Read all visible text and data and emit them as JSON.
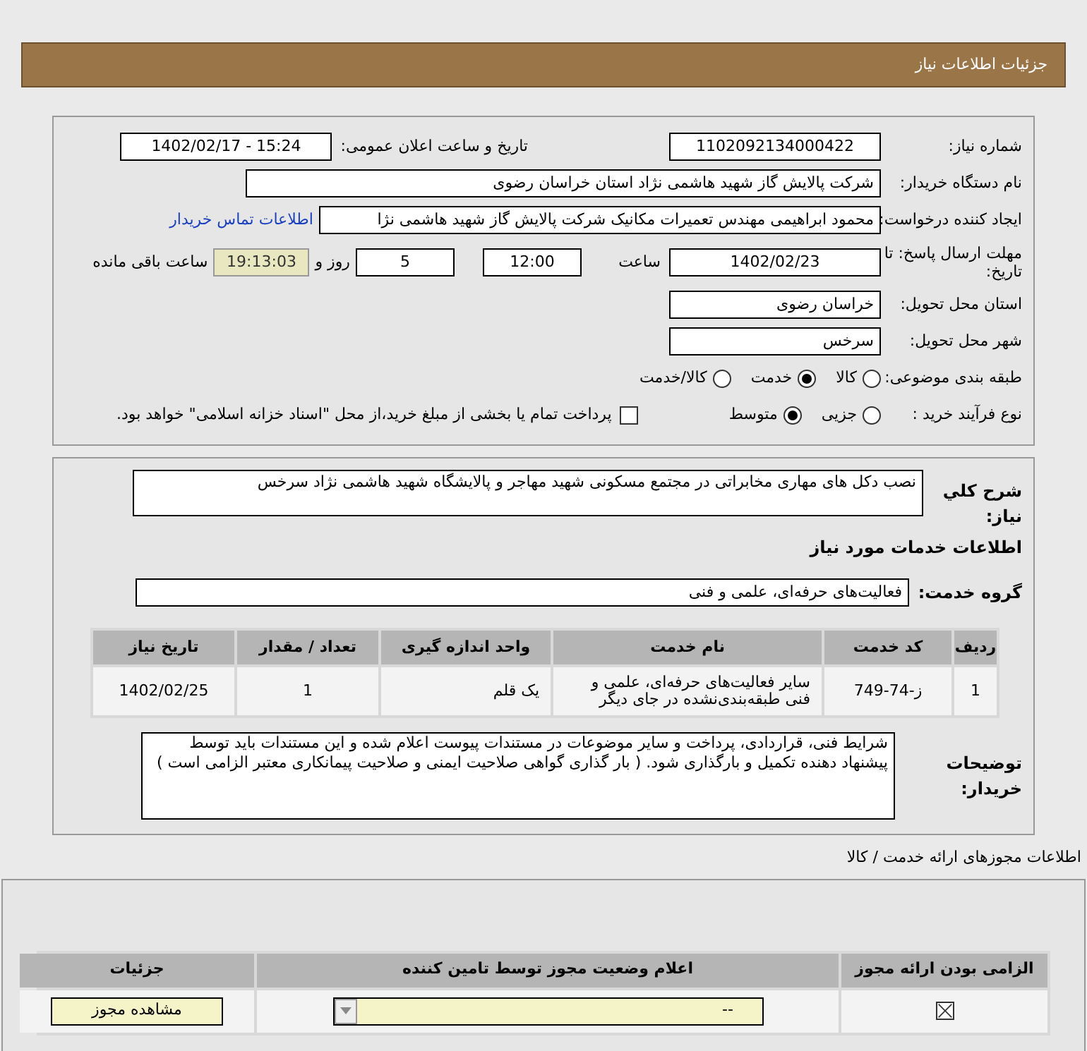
{
  "header": {
    "title": "جزئیات اطلاعات نیاز"
  },
  "details": {
    "need_number": {
      "label": "شماره نیاز:",
      "value": "1102092134000422"
    },
    "announce": {
      "label": "تاریخ و ساعت اعلان عمومی:",
      "value": "1402/02/17 - 15:24"
    },
    "buyer": {
      "label": "نام دستگاه خریدار:",
      "value": "شرکت پالایش گاز شهید هاشمی نژاد   استان خراسان رضوی"
    },
    "requester": {
      "label": "ایجاد کننده درخواست:",
      "value": "محمود ابراهیمی مهندس تعمیرات مکانیک شرکت پالایش گاز شهید هاشمی نژا",
      "link": "اطلاعات تماس خریدار"
    },
    "deadline": {
      "label": "مهلت ارسال پاسخ: تا تاریخ:",
      "date": "1402/02/23",
      "time_label": "ساعت",
      "time": "12:00",
      "days": "5",
      "days_label": "روز و",
      "remaining": "19:13:03",
      "remaining_label": "ساعت باقی مانده"
    },
    "province": {
      "label": "استان محل تحویل:",
      "value": "خراسان رضوی"
    },
    "city": {
      "label": "شهر محل تحویل:",
      "value": "سرخس"
    },
    "category": {
      "label": "طبقه بندی موضوعی:",
      "options": [
        {
          "label": "کالا",
          "selected": false
        },
        {
          "label": "خدمت",
          "selected": true
        },
        {
          "label": "کالا/خدمت",
          "selected": false
        }
      ]
    },
    "process": {
      "label": "نوع فرآیند خرید :",
      "options": [
        {
          "label": "جزیی",
          "selected": false
        },
        {
          "label": "متوسط",
          "selected": true
        }
      ],
      "treasury": {
        "label": "پرداخت تمام یا بخشی از مبلغ خرید،از محل \"اسناد خزانه اسلامی\" خواهد بود.",
        "checked": false
      }
    }
  },
  "need": {
    "description_label": "شرح کلي نياز:",
    "description": "نصب دکل های مهاری مخابراتی در مجتمع مسکونی شهید مهاجر و پالایشگاه شهید هاشمی نژاد سرخس",
    "services_title": "اطلاعات خدمات مورد نياز",
    "group_label": "گروه خدمت:",
    "group": "فعالیت‌های حرفه‌ای، علمی و فنی",
    "table": {
      "columns": [
        "ردیف",
        "کد خدمت",
        "نام خدمت",
        "واحد اندازه گیری",
        "تعداد / مقدار",
        "تاریخ نیاز"
      ],
      "rows": [
        [
          "1",
          "ز-74-749",
          "سایر فعالیت‌های حرفه‌ای، علمی و فنی طبقه‌بندی‌نشده در جای دیگر",
          "یک قلم",
          "1",
          "1402/02/25"
        ]
      ]
    },
    "notes_label": "توضیحات خریدار:",
    "notes": "شرایط فنی، قراردادی، پرداخت و سایر موضوعات در مستندات پیوست اعلام شده و این مستندات باید توسط پیشنهاد دهنده تکمیل و  بارگذاری شود. ( بار گذاری گواهی صلاحیت ایمنی و صلاحیت پیمانکاری معتبر الزامی است )"
  },
  "licenses": {
    "title": "اطلاعات مجوزهای ارائه خدمت / کالا",
    "columns": [
      "الزامی بودن ارائه مجوز",
      "اعلام وضعیت مجوز توسط تامین کننده",
      "جزئیات"
    ],
    "rows": [
      {
        "required": true,
        "status": "--",
        "button": "مشاهده مجوز"
      }
    ]
  }
}
